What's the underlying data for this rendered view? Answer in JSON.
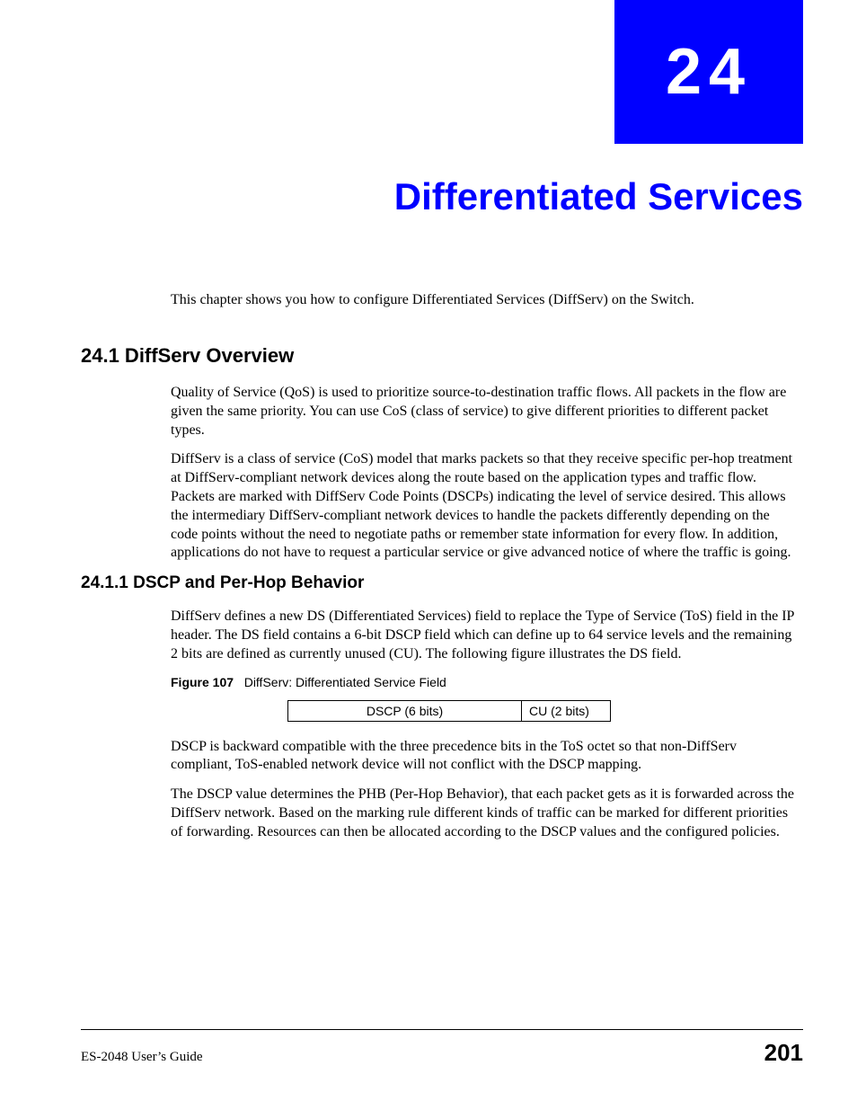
{
  "chapter": {
    "number": "24",
    "title": "Differentiated Services"
  },
  "intro": "This chapter shows you how to configure Differentiated Services (DiffServ) on the Switch.",
  "sections": {
    "s1": {
      "heading": "24.1  DiffServ Overview",
      "p1": "Quality of Service (QoS) is used to prioritize source-to-destination traffic flows. All packets in the flow are given the same priority. You can use CoS (class of service) to give different priorities to different packet types.",
      "p2": "DiffServ is a class of service (CoS) model that marks packets so that they receive specific per-hop treatment at DiffServ-compliant network devices along the route based on the application types and traffic flow. Packets are marked with DiffServ Code Points (DSCPs) indicating the level of service desired. This allows the intermediary DiffServ-compliant network devices to handle the packets differently depending on the code points without the need to negotiate paths or remember state information for every flow. In addition, applications do not have to request a particular service or give advanced notice of where the traffic is going."
    },
    "s11": {
      "heading": "24.1.1  DSCP and Per-Hop Behavior",
      "p1": "DiffServ defines a new DS (Differentiated Services) field to replace the Type of Service (ToS) field in the IP header. The DS field contains a 6-bit DSCP field which can define up to 64 service levels and the remaining 2 bits are defined as currently unused (CU). The following figure illustrates the DS field.",
      "figure_label": "Figure 107",
      "figure_caption": "DiffServ: Differentiated Service Field",
      "ds_field": {
        "dscp": "DSCP (6 bits)",
        "cu": "CU (2 bits)"
      },
      "p2": "DSCP is backward compatible with the three precedence bits in the ToS octet so that non-DiffServ compliant, ToS-enabled network device will not conflict with the DSCP mapping.",
      "p3": "The DSCP value determines the PHB (Per-Hop Behavior), that each packet gets as it is forwarded across the DiffServ network. Based on the marking rule different kinds of traffic can be marked for different priorities of forwarding. Resources can then be allocated according to the DSCP values and the configured policies."
    }
  },
  "footer": {
    "guide": "ES-2048 User’s Guide",
    "page": "201"
  }
}
